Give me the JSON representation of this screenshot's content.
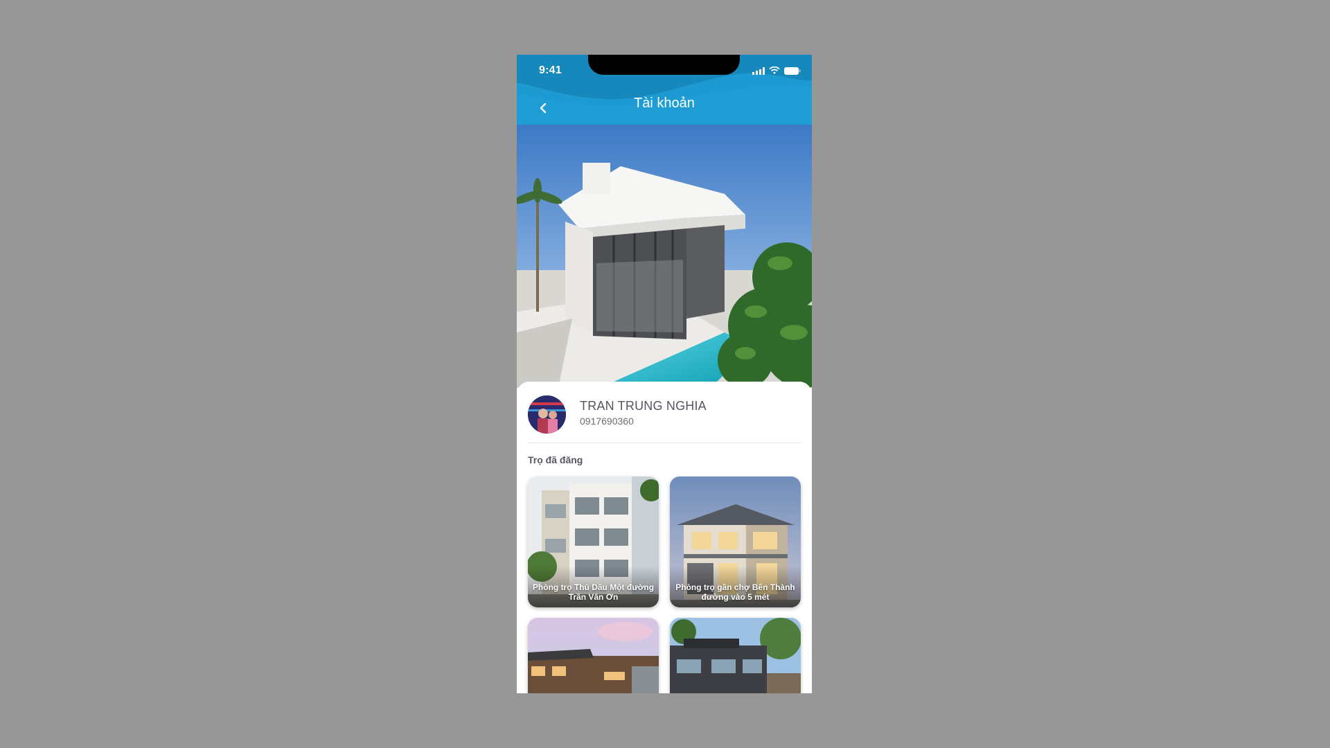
{
  "status_bar": {
    "time": "9:41",
    "icons": [
      "signal-icon",
      "wifi-icon",
      "battery-icon"
    ]
  },
  "header": {
    "title": "Tài khoản",
    "back_icon": "chevron-left-icon"
  },
  "profile": {
    "name": "TRAN TRUNG NGHIA",
    "phone": "0917690360"
  },
  "posts_section": {
    "title": "Trọ đã đăng",
    "items": [
      {
        "caption": "Phòng trọ Thủ Dầu Một đường Trần Văn Ơn"
      },
      {
        "caption": "Phòng trọ gần chợ Bến Thành đường vào 5 mét"
      },
      {
        "caption": ""
      },
      {
        "caption": ""
      }
    ]
  },
  "colors": {
    "header": "#1c9ad1",
    "background": "#979797",
    "text": "#55565f"
  }
}
